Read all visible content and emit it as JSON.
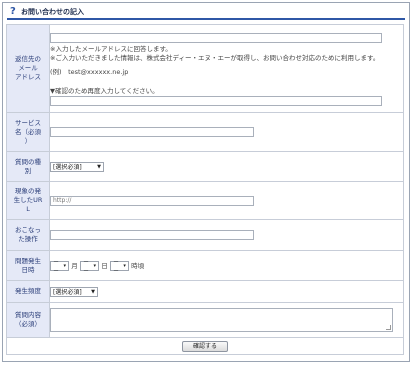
{
  "header": {
    "title": "お問い合わせの記入"
  },
  "email": {
    "label": [
      "返信先の",
      "メール",
      "アドレス"
    ],
    "note1": "※入力したメールアドレスに回答します。",
    "note2": "※ご入力いただきました情報は、株式会社ディー・エヌ・エーが取得し、お問い合わせ対応のために利用します。",
    "example": "(例)　test@xxxxxx.ne.jp",
    "confirm_note": "▼確認のため再度入力してください。"
  },
  "service": {
    "label": [
      "サービス",
      "名（必須",
      "）"
    ]
  },
  "question_type": {
    "label": [
      "質問の種",
      "別"
    ],
    "selected": "[選択必須]"
  },
  "url": {
    "label": [
      "現象の発",
      "生したUR",
      "L"
    ],
    "placeholder": "http://"
  },
  "operation": {
    "label": [
      "おこなっ",
      "た操作"
    ]
  },
  "datetime": {
    "label": [
      "問題発生",
      "日時"
    ],
    "month_value": "－－",
    "month_unit": "月",
    "day_value": "－－",
    "day_unit": "日",
    "hour_value": "－－",
    "hour_unit": "時頃"
  },
  "frequency": {
    "label": [
      "発生頻度"
    ],
    "selected": "[選択必須]"
  },
  "details": {
    "label": [
      "質問内容",
      "（必須）"
    ]
  },
  "submit": {
    "label": "確認する"
  }
}
